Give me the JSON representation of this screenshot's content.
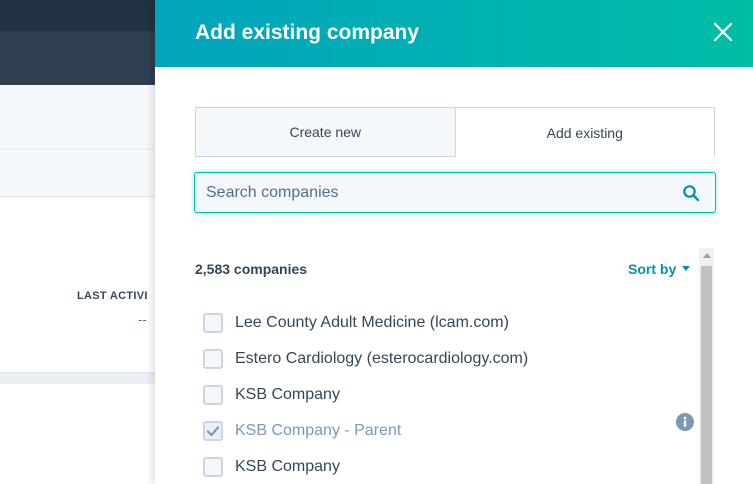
{
  "background": {
    "column_header": "LAST ACTIVI",
    "column_value": "--"
  },
  "panel": {
    "title": "Add existing company",
    "tabs": [
      {
        "label": "Create new",
        "active": false
      },
      {
        "label": "Add existing",
        "active": true
      }
    ],
    "search": {
      "placeholder": "Search companies",
      "value": ""
    },
    "count_label": "2,583 companies",
    "sort_label": "Sort by",
    "items": [
      {
        "label": "Lee County Adult Medicine (lcam.com)",
        "checked": false,
        "disabled": false
      },
      {
        "label": "Estero Cardiology (esterocardiology.com)",
        "checked": false,
        "disabled": false
      },
      {
        "label": "KSB Company",
        "checked": false,
        "disabled": false
      },
      {
        "label": "KSB Company - Parent",
        "checked": true,
        "disabled": true
      },
      {
        "label": "KSB Company",
        "checked": false,
        "disabled": false
      }
    ]
  },
  "icons": {
    "close": "close-icon",
    "search": "search-icon",
    "info": "info-icon",
    "sort_caret": "caret-down-icon"
  },
  "colors": {
    "header_gradient_start": "#00a4bd",
    "header_gradient_end": "#00bda5",
    "link": "#0091ae",
    "text": "#33475b",
    "dark_nav": "#213343"
  }
}
